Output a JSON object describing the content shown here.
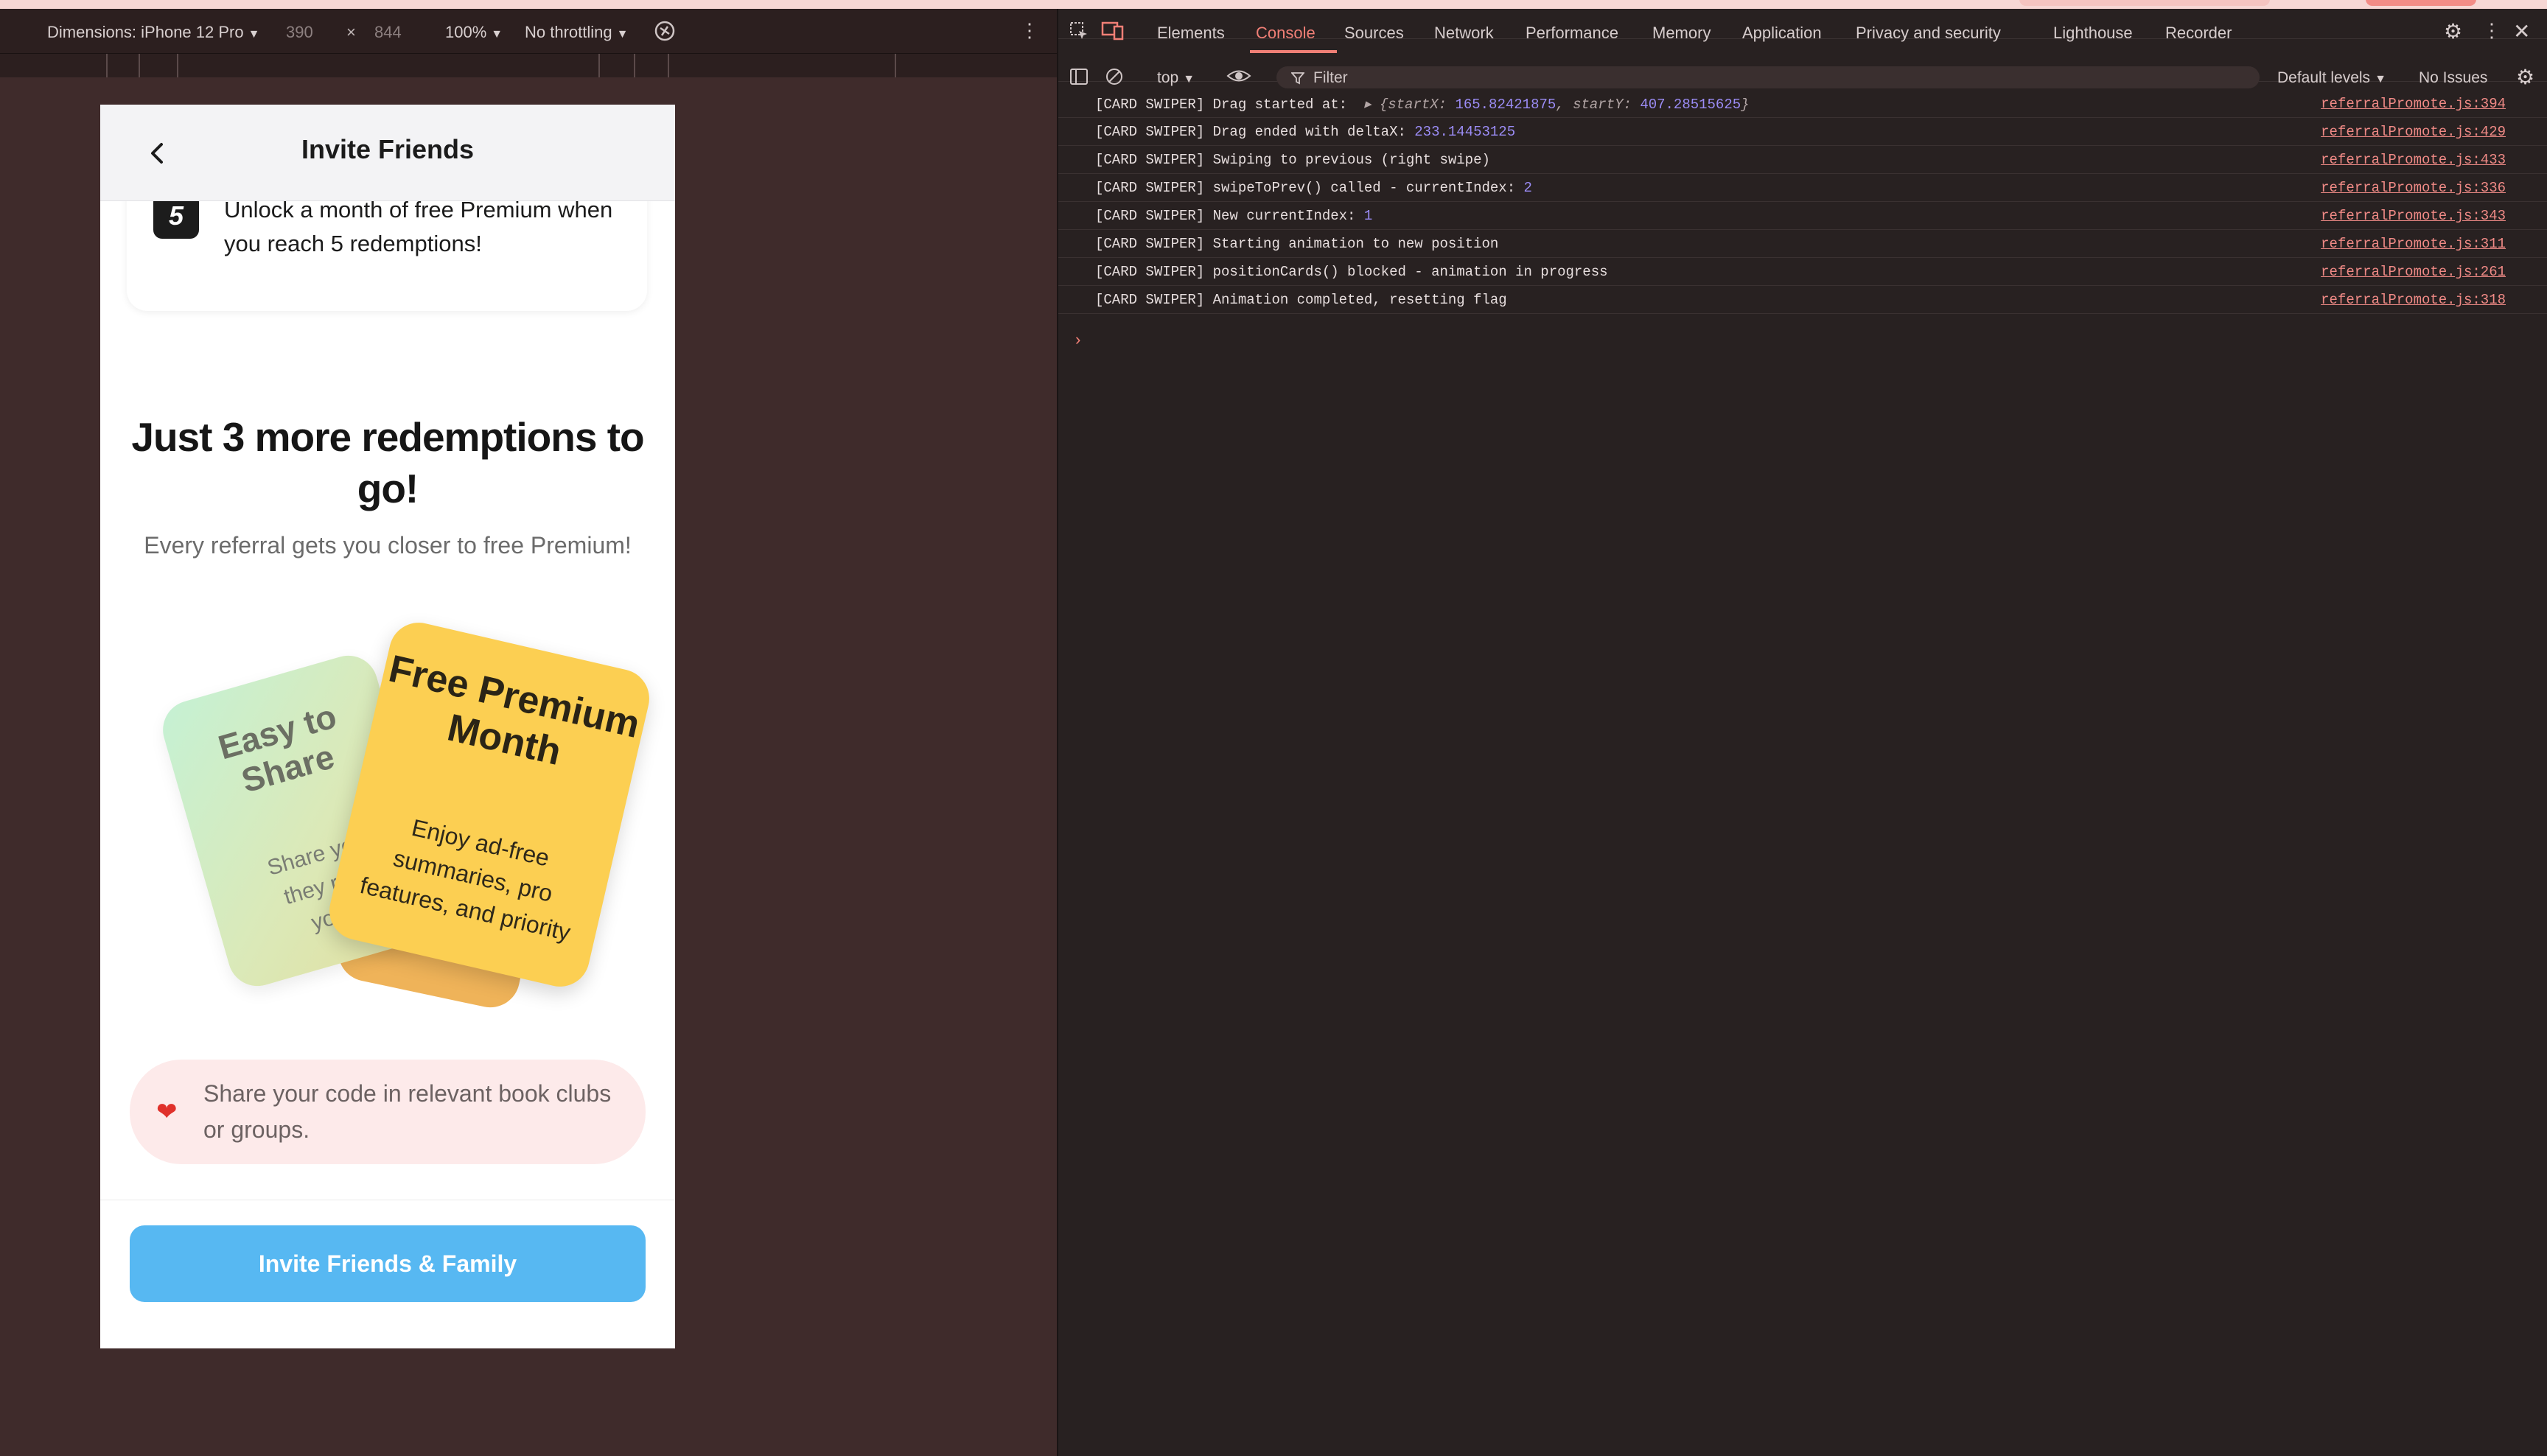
{
  "emulation": {
    "device_label": "Dimensions: iPhone 12 Pro",
    "width": "390",
    "times": "×",
    "height": "844",
    "zoom": "100%",
    "throttling": "No throttling"
  },
  "phone": {
    "header_title": "Invite Friends",
    "step_number": "5",
    "step_text": "Unlock a month of free Premium when you reach 5 redemptions!",
    "headline": "Just 3 more redemptions to go!",
    "subline": "Every referral gets you closer to free Premium!",
    "cards": {
      "back_title": "Easy to Share",
      "back_body": "Share your\nthey rede\nyou b",
      "front_title": "Free Premium Month",
      "front_body": "Enjoy ad-free summaries, pro features, and priority"
    },
    "tip_text": "Share your code in relevant book clubs or groups.",
    "cta_label": "Invite Friends & Family"
  },
  "devtools": {
    "tabs": [
      "Elements",
      "Console",
      "Sources",
      "Network",
      "Performance",
      "Memory",
      "Application",
      "Privacy and security",
      "Lighthouse",
      "Recorder"
    ],
    "active_tab": "Console",
    "context": "top",
    "filter_placeholder": "Filter",
    "levels": "Default levels",
    "issues": "No Issues",
    "logs": [
      {
        "prefix": "[CARD SWIPER] Drag started at: ",
        "expander": "▸",
        "obj_open": "{",
        "k1": "startX: ",
        "v1": "165.82421875",
        "sep": ", ",
        "k2": "startY: ",
        "v2": "407.28515625",
        "obj_close": "}",
        "source": "referralPromote.js:394"
      },
      {
        "prefix": "[CARD SWIPER] Drag ended with deltaX: ",
        "value": "233.14453125",
        "source": "referralPromote.js:429"
      },
      {
        "prefix": "[CARD SWIPER] Swiping to previous (right swipe)",
        "source": "referralPromote.js:433"
      },
      {
        "prefix": "[CARD SWIPER] swipeToPrev() called - currentIndex: ",
        "value": "2",
        "source": "referralPromote.js:336"
      },
      {
        "prefix": "[CARD SWIPER] New currentIndex: ",
        "value": "1",
        "source": "referralPromote.js:343"
      },
      {
        "prefix": "[CARD SWIPER] Starting animation to new position",
        "source": "referralPromote.js:311"
      },
      {
        "prefix": "[CARD SWIPER] positionCards() blocked - animation in progress",
        "source": "referralPromote.js:261"
      },
      {
        "prefix": "[CARD SWIPER] Animation completed, resetting flag",
        "source": "referralPromote.js:318"
      }
    ],
    "prompt": "›"
  },
  "colors": {
    "cta": "#57b8f2",
    "card_yellow": "#fccf52",
    "active_tab": "#f07f76",
    "log_number": "#9b8cf5"
  }
}
